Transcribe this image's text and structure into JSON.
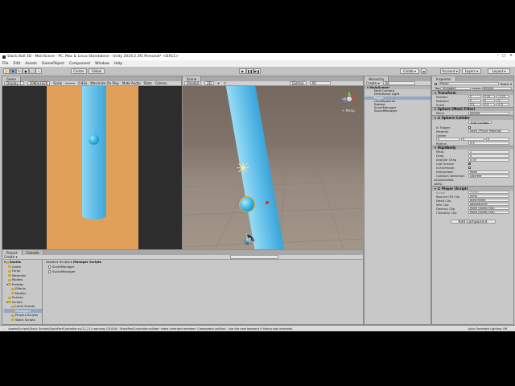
{
  "window": {
    "title": "Stack Ball 3D - MainScene - PC, Mac & Linux Standalone - Unity 2019.2.3f1 Personal* <DX11>"
  },
  "menu": [
    "File",
    "Edit",
    "Assets",
    "GameObject",
    "Component",
    "Window",
    "Help"
  ],
  "toolbar": {
    "pivot": "Center",
    "space": "Global",
    "play": "▶",
    "pause": "❚❚",
    "step": "▶❚",
    "collab": "Collab ▾",
    "account": "Account ▾",
    "layers": "Layers ▾",
    "layout": "Layout ▾"
  },
  "game_view": {
    "tab": "Game",
    "display": "Display 1",
    "resolution": "1080x1920",
    "scale_label": "Scale",
    "scale_value": "0.83x",
    "maximize": "Maximize On Play",
    "mute": "Mute Audio",
    "stats": "Stats",
    "gizmos": "Gizmos"
  },
  "scene_view": {
    "tab": "Scene",
    "shading": "Shaded",
    "mode_2d": "2D",
    "gizmos": "Gizmos",
    "search": "All",
    "persp": "< Persp"
  },
  "hierarchy": {
    "tab": "Hierarchy",
    "create": "Create ▾",
    "search": "All",
    "scene": "MainScene*",
    "items": [
      "Main Camera",
      "Directional Light",
      "Player",
      "LevelSpawner",
      "Rotator",
      "ScoreManager",
      "SoundManager"
    ],
    "selected": "Player"
  },
  "project": {
    "tabs": [
      "Project",
      "Console"
    ],
    "create": "Create ▾",
    "tree": [
      "Assets",
      "Audio",
      "Fonts",
      "Materials",
      "Models",
      "Prefabs",
      "Effects",
      "Models",
      "Scenes",
      "Scripts",
      "Level Scripts",
      "Managers",
      "Players Scripts",
      "Stack Scripts",
      "Textures",
      "Packages"
    ],
    "breadcrumb": [
      "Assets",
      "Scripts",
      "Manager Scripts"
    ],
    "files": [
      "ScoreManager",
      "SoundManager"
    ]
  },
  "inspector": {
    "tab": "Inspector",
    "name": "Player",
    "static": "Static ▾",
    "tag_label": "Tag",
    "tag": "Untagged",
    "layer_label": "Layer",
    "layer": "Default",
    "transform": {
      "title": "Transform",
      "rows": [
        {
          "label": "Position",
          "x": "0",
          "y": "2.15",
          "z": "-1.12"
        },
        {
          "label": "Rotation",
          "x": "0",
          "y": "0",
          "z": "0"
        },
        {
          "label": "Scale",
          "x": "0.3",
          "y": "0.3",
          "z": "0.3"
        }
      ]
    },
    "mesh_filter": {
      "title": "Sphere (Mesh Filter)",
      "mesh_label": "Mesh",
      "mesh": "Sphere"
    },
    "sphere_collider": {
      "title": "Sphere Collider",
      "edit": "Edit Collider",
      "is_trigger": "Is Trigger",
      "material_label": "Material",
      "material": "None (Physic Material)",
      "center_label": "Center",
      "center": {
        "x": "0",
        "y": "0",
        "z": "0"
      },
      "radius_label": "Radius",
      "radius": "0.5"
    },
    "rigidbody": {
      "title": "Rigidbody",
      "rows": [
        {
          "label": "Mass",
          "value": "1"
        },
        {
          "label": "Drag",
          "value": "0"
        },
        {
          "label": "Angular Drag",
          "value": "0.05"
        }
      ],
      "use_gravity": "Use Gravity",
      "is_kinematic": "Is Kinematic",
      "interpolate_label": "Interpolate",
      "interpolate": "None",
      "collision_label": "Collision Detection",
      "collision": "Discrete",
      "constraints": "Constraints",
      "info": "Info"
    },
    "player_script": {
      "title": "Player (Script)",
      "script_label": "Script",
      "script": "Player",
      "rows": [
        {
          "label": "Bounce Off Clip",
          "value": "jump"
        },
        {
          "label": "Dead Clip",
          "value": "playerDied"
        },
        {
          "label": "Win Clip",
          "value": "passedLevel"
        },
        {
          "label": "Destroy Clip",
          "value": "None (Audio Clip)"
        },
        {
          "label": "I Destroy Clip",
          "value": "None (Audio Clip)"
        }
      ]
    },
    "add_component": "Add Component"
  },
  "status": {
    "message": "Assets\\Scripts\\Stack Scripts\\StackPartController.cs(12,21): warning CS0108: 'StackPartController.collider' hides inherited member 'Component.collider'. Use the new keyword if hiding was intended.",
    "right": "Auto Generate Lighting Off"
  },
  "colors": {
    "pole": "#6fc4ea",
    "ball": "#1da5d6",
    "game_bg": "#e0a05a",
    "scene_sky": "#7a6e66",
    "scene_ground": "#9c9086"
  }
}
